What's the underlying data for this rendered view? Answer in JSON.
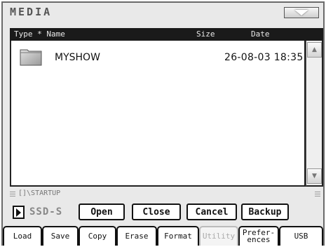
{
  "header": {
    "title": "MEDIA",
    "menu_icon": "chevron-down-icon"
  },
  "columns": {
    "type_name": "Type * Name",
    "size": "Size",
    "date": "Date"
  },
  "files": [
    {
      "icon": "folder-icon",
      "name": "MYSHOW",
      "size": "",
      "date": "26-08-03 18:35"
    }
  ],
  "path": "[]\\STARTUP",
  "drive": {
    "label": "SSD-S"
  },
  "actions": {
    "open": "Open",
    "close": "Close",
    "cancel": "Cancel",
    "backup": "Backup"
  },
  "tabs": [
    {
      "label": "Load",
      "enabled": true
    },
    {
      "label": "Save",
      "enabled": true
    },
    {
      "label": "Copy",
      "enabled": true
    },
    {
      "label": "Erase",
      "enabled": true
    },
    {
      "label": "Format",
      "enabled": true
    },
    {
      "label": "Utility",
      "enabled": false
    },
    {
      "label": "Prefer-\nences",
      "enabled": true
    },
    {
      "label": "USB",
      "enabled": true
    }
  ]
}
